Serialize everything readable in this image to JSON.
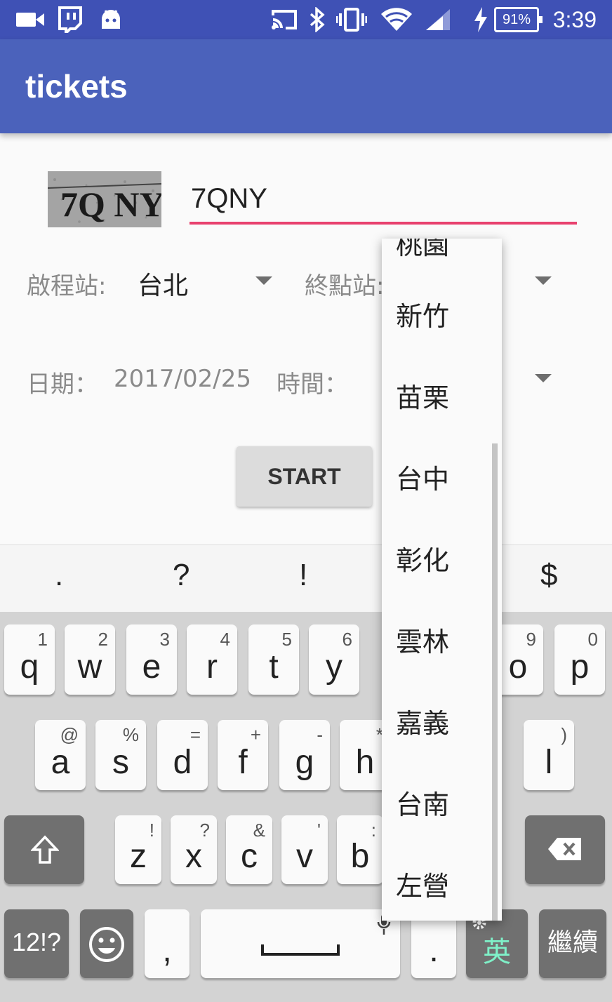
{
  "status_bar": {
    "icons": [
      "video-icon",
      "twitch-icon",
      "android-icon",
      "cast-icon",
      "bluetooth-icon",
      "vibrate-icon",
      "wifi-icon",
      "signal-icon",
      "charging-icon"
    ],
    "battery": "91%",
    "time": "3:39"
  },
  "app": {
    "title": "tickets"
  },
  "form": {
    "captcha_text": "7Q NY",
    "code_value": "7QNY",
    "start_station_label": "啟程站:",
    "start_station_value": "台北",
    "end_station_label": "終點站:",
    "date_label": "日期：",
    "date_value": "2017/02/25",
    "time_label": "時間：",
    "start_button": "START"
  },
  "dropdown": {
    "items": [
      "桃園",
      "新竹",
      "苗栗",
      "台中",
      "彰化",
      "雲林",
      "嘉義",
      "台南",
      "左營"
    ]
  },
  "keyboard": {
    "suggestions": [
      ".",
      "?",
      "!",
      "$"
    ],
    "row1": [
      {
        "key": "q",
        "hint": "1"
      },
      {
        "key": "w",
        "hint": "2"
      },
      {
        "key": "e",
        "hint": "3"
      },
      {
        "key": "r",
        "hint": "4"
      },
      {
        "key": "t",
        "hint": "5"
      },
      {
        "key": "y",
        "hint": "6"
      },
      {
        "key": "o",
        "hint": "9"
      },
      {
        "key": "p",
        "hint": "0"
      }
    ],
    "row2": [
      {
        "key": "a",
        "hint": "@"
      },
      {
        "key": "s",
        "hint": "%"
      },
      {
        "key": "d",
        "hint": "="
      },
      {
        "key": "f",
        "hint": "+"
      },
      {
        "key": "g",
        "hint": "-"
      },
      {
        "key": "h",
        "hint": "*"
      },
      {
        "key": "l",
        "hint": ")"
      }
    ],
    "row3": [
      {
        "key": "z",
        "hint": "!"
      },
      {
        "key": "x",
        "hint": "?"
      },
      {
        "key": "c",
        "hint": "&"
      },
      {
        "key": "v",
        "hint": "'"
      },
      {
        "key": "b",
        "hint": ":"
      }
    ],
    "symbols_key": "12!?",
    "comma_key": ",",
    "period_key": ".",
    "lang_key": "英",
    "enter_key": "繼續",
    "colors": {
      "background": "#d3d3d3",
      "key": "#fafafa",
      "dark_key": "#707070"
    }
  },
  "colors": {
    "app_bar": "#4b62bb",
    "status_bar": "#3f51b5",
    "accent": "#e8416e"
  }
}
